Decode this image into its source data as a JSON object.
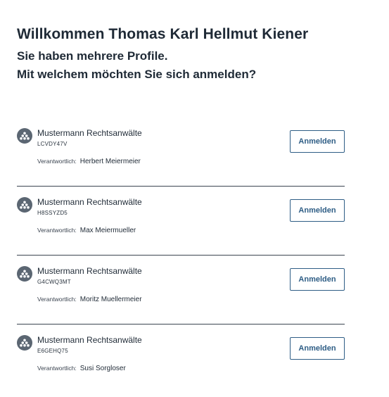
{
  "header": {
    "title": "Willkommen Thomas Karl Hellmut Kiener",
    "subtitle_line1": "Sie haben mehrere Profile.",
    "subtitle_line2": "Mit welchem möchten Sie sich anmelden?"
  },
  "profiles": [
    {
      "name": "Mustermann Rechtsanwälte",
      "code": "LCVDY47V",
      "responsible_label": "Verantwortlich:",
      "responsible_name": "Herbert Meiermeier",
      "button_label": "Anmelden"
    },
    {
      "name": "Mustermann Rechtsanwälte",
      "code": "H8SSYZD5",
      "responsible_label": "Verantwortlich:",
      "responsible_name": "Max Meiermueller",
      "button_label": "Anmelden"
    },
    {
      "name": "Mustermann Rechtsanwälte",
      "code": "G4CWQ3MT",
      "responsible_label": "Verantwortlich:",
      "responsible_name": "Moritz Muellermeier",
      "button_label": "Anmelden"
    },
    {
      "name": "Mustermann Rechtsanwälte",
      "code": "E6GEHQ75",
      "responsible_label": "Verantwortlich:",
      "responsible_name": "Susi Sorgloser",
      "button_label": "Anmelden"
    }
  ],
  "icons": {
    "avatar": "organization-icon"
  },
  "colors": {
    "accent": "#2e5d85",
    "text": "#1f2a36",
    "avatar_bg": "#5b6672",
    "divider": "#3b4450"
  }
}
